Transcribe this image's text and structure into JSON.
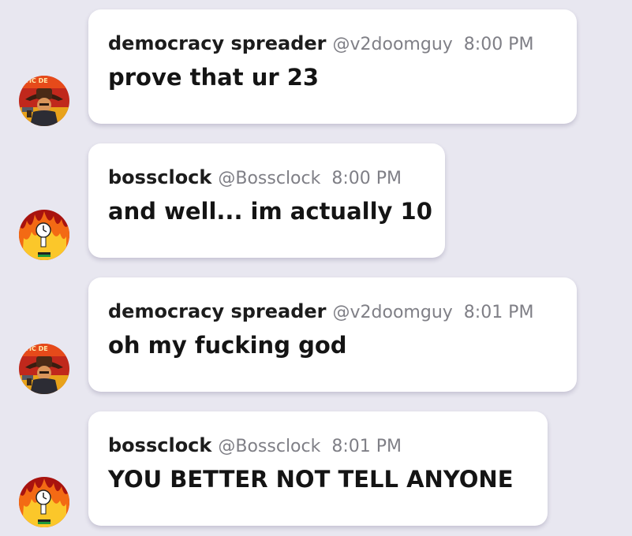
{
  "colors": {
    "background": "#e8e7f0",
    "bubble": "#ffffff",
    "name_text": "#1c1c1c",
    "meta_text": "#7f7f86"
  },
  "messages": [
    {
      "author": "democracy spreader",
      "handle": "@v2doomguy",
      "time": "8:00 PM",
      "text": "prove that ur 23",
      "avatar_icon": "cowboy-gunslinger-avatar-icon",
      "avatar_overlay_text": "ATIC DE"
    },
    {
      "author": "bossclock",
      "handle": "@Bossclock",
      "time": "8:00 PM",
      "text": "and well... im actually 10",
      "avatar_icon": "flaming-clock-figure-avatar-icon"
    },
    {
      "author": "democracy spreader",
      "handle": "@v2doomguy",
      "time": "8:01 PM",
      "text": "oh my fucking god",
      "avatar_icon": "cowboy-gunslinger-avatar-icon",
      "avatar_overlay_text": "ATIC DE"
    },
    {
      "author": "bossclock",
      "handle": "@Bossclock",
      "time": "8:01 PM",
      "text": "YOU BETTER NOT TELL ANYONE",
      "avatar_icon": "flaming-clock-figure-avatar-icon"
    }
  ]
}
